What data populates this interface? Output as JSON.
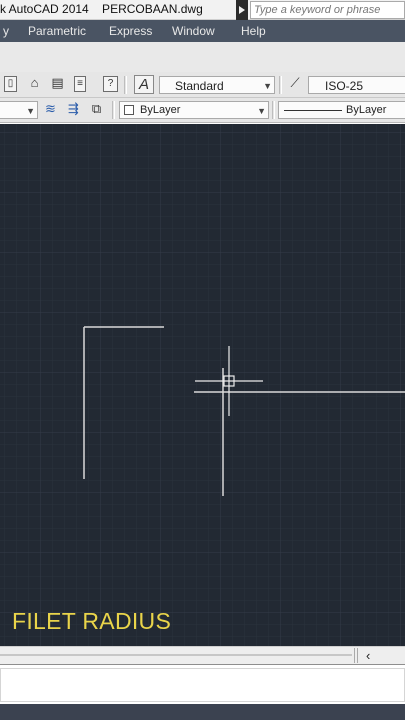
{
  "title": {
    "text": "k AutoCAD 2014    PERCOBAAN.dwg",
    "search_placeholder": "Type a keyword or phrase"
  },
  "menu": {
    "items": [
      "y",
      "Parametric",
      "Express",
      "Window",
      "Help"
    ]
  },
  "toolbar": {
    "text_style": "Standard",
    "dim_style": "ISO-25",
    "layer_color": "ByLayer",
    "linetype": "ByLayer",
    "text_style_icon": "A"
  },
  "canvas": {
    "caption": "FILET RADIUS",
    "background": "#222933",
    "caption_color": "#e9d44a"
  }
}
